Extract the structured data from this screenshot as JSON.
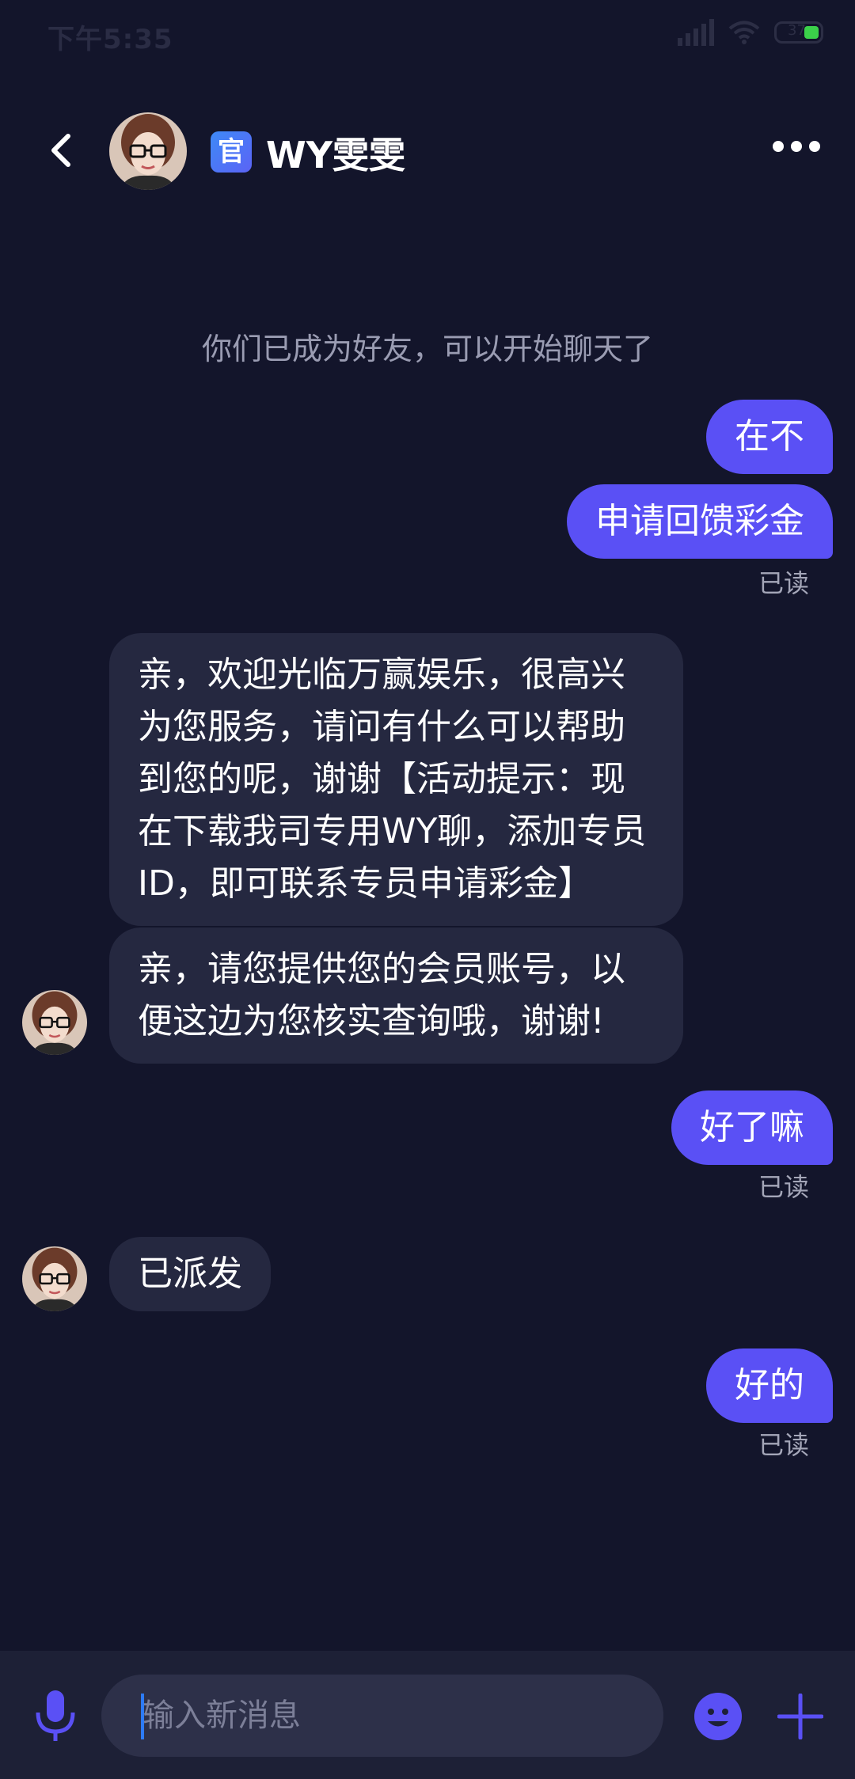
{
  "status_bar": {
    "time": "下午5:35",
    "battery": "37"
  },
  "header": {
    "badge": "官",
    "title": "WY雯雯"
  },
  "system_note": "你们已成为好友，可以开始聊天了",
  "messages": [
    {
      "side": "out",
      "text": "在不"
    },
    {
      "side": "out",
      "text": "申请回馈彩金",
      "status": "已读"
    },
    {
      "side": "in",
      "text": "亲，欢迎光临万赢娱乐，很高兴为您服务，请问有什么可以帮助到您的呢，谢谢【活动提示：现在下载我司专用WY聊，添加专员ID，即可联系专员申请彩金】"
    },
    {
      "side": "in",
      "text": "亲，请您提供您的会员账号，以便这边为您核实查询哦，谢谢!"
    },
    {
      "side": "out",
      "text": "好了嘛",
      "status": "已读"
    },
    {
      "side": "in",
      "text": "已派发"
    },
    {
      "side": "out",
      "text": "好的",
      "status": "已读"
    }
  ],
  "input": {
    "placeholder": "输入新消息",
    "value": ""
  },
  "icons": {
    "back": "chevron-left-icon",
    "more": "more-dots-icon",
    "mic": "microphone-icon",
    "emoji": "emoji-icon",
    "plus": "plus-icon"
  },
  "colors": {
    "background": "#13152b",
    "outgoing_bubble": "#5a50f5",
    "incoming_bubble": "#252840",
    "accent": "#5a50f5"
  }
}
